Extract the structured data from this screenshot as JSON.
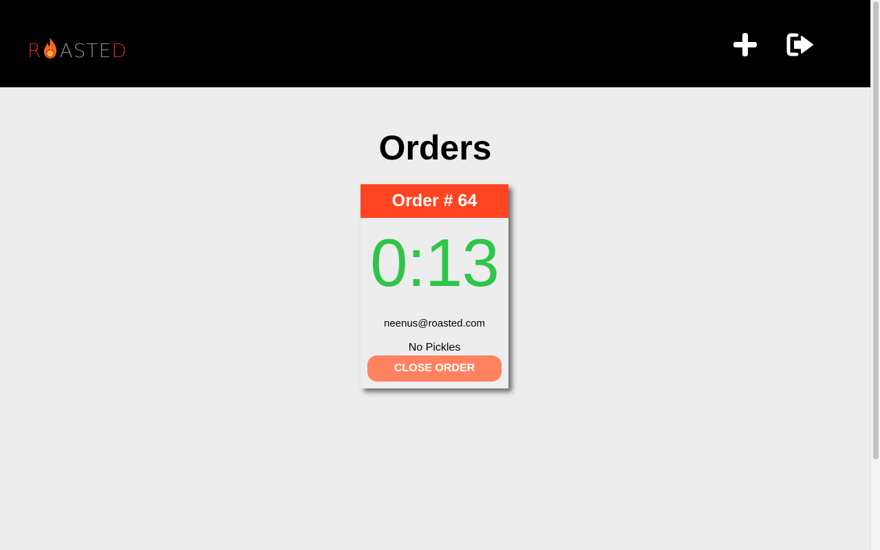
{
  "brand": {
    "letters": [
      "R",
      "A",
      "S",
      "T",
      "E",
      "D"
    ],
    "colors": {
      "red": "#e2262b",
      "flame_outer": "#f26a21",
      "flame_inner": "#fcb23b",
      "grey": "#8a8a8a"
    }
  },
  "header": {
    "actions": [
      {
        "icon": "plus-icon"
      },
      {
        "icon": "sign-out-icon"
      }
    ]
  },
  "main": {
    "title": "Orders",
    "orders": [
      {
        "title": "Order # 64",
        "timer": "0:13",
        "email": "neenus@roasted.com",
        "notes": "No Pickles",
        "close_label": "CLOSE ORDER"
      }
    ]
  },
  "colors": {
    "header_bg": "#000000",
    "page_bg": "#ededed",
    "card_header": "#ff4422",
    "timer_green": "#2ec548",
    "close_button": "#ff8260"
  }
}
